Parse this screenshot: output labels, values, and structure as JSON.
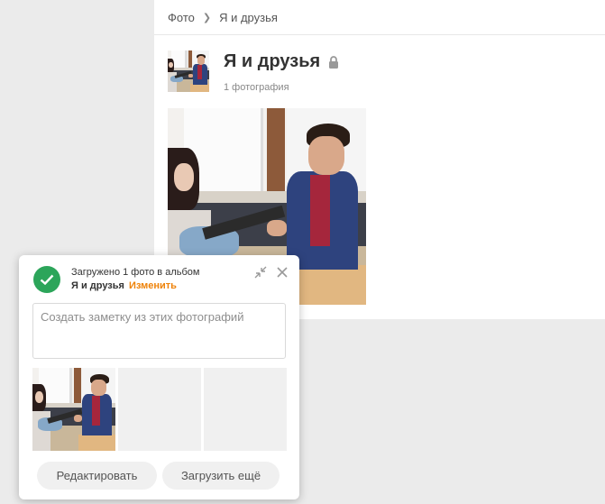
{
  "breadcrumb": {
    "root": "Фото",
    "current": "Я и друзья"
  },
  "album": {
    "title": "Я и друзья",
    "count": "1 фотография",
    "lock_icon": "lock-icon"
  },
  "popup": {
    "status_text": "Загружено 1 фото в альбом",
    "album_name": "Я и друзья",
    "change_link": "Изменить",
    "note_placeholder": "Создать заметку из этих фотографий",
    "note_value": "",
    "edit_button": "Редактировать",
    "upload_more_button": "Загрузить ещё",
    "icons": [
      "check-icon",
      "collapse-icon",
      "close-icon"
    ]
  },
  "colors": {
    "success": "#2ca55a",
    "link_accent": "#ee8208",
    "page_bg": "#ebebeb"
  }
}
